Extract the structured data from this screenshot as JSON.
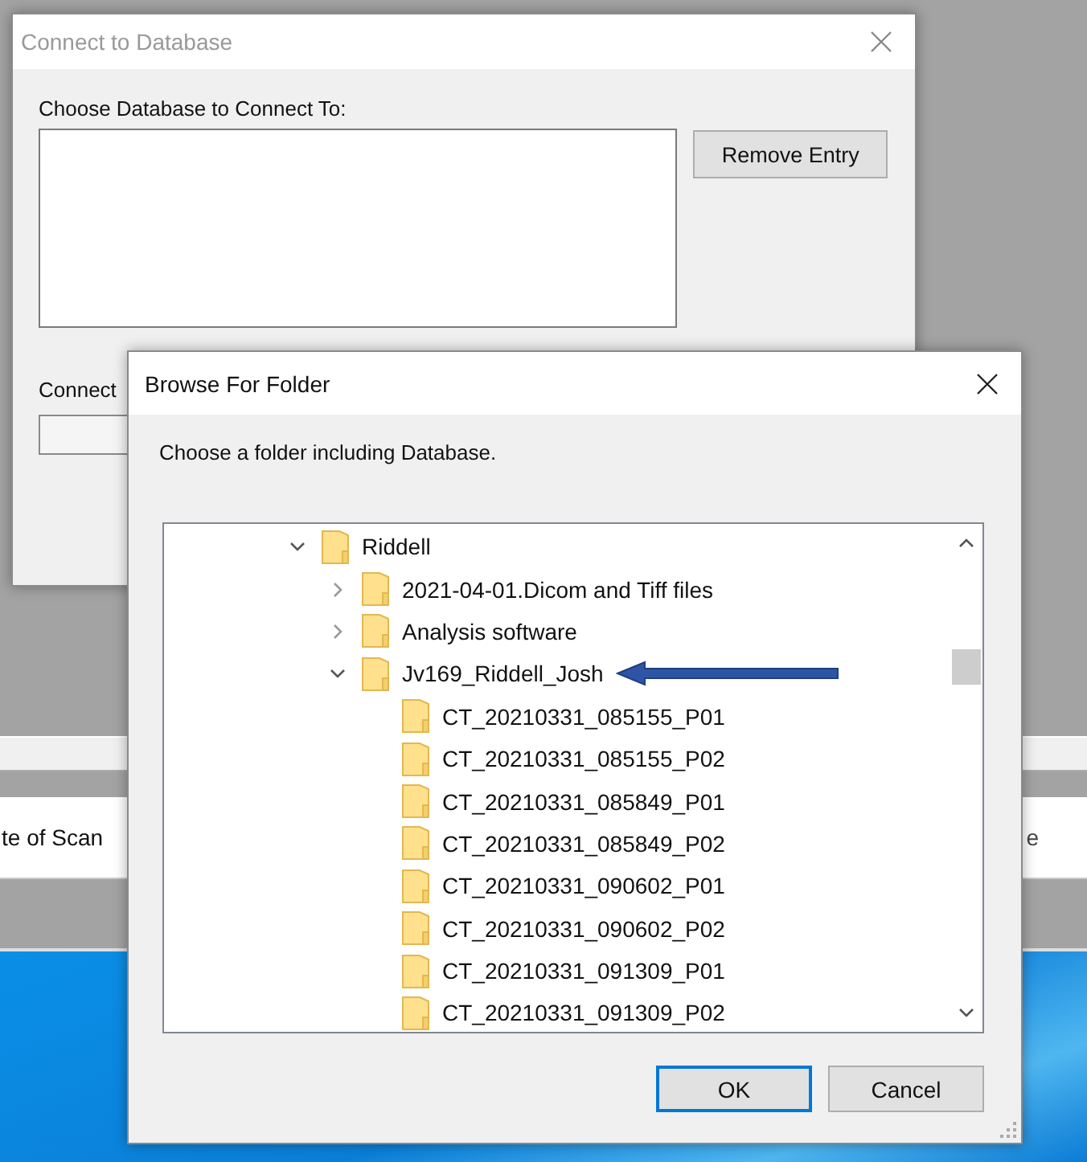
{
  "background_app": {
    "column_1": "te of Scan",
    "column_2": "e"
  },
  "connect_dialog": {
    "title": "Connect to Database",
    "active": false,
    "list_label": "Choose Database to Connect To:",
    "remove_button": "Remove Entry",
    "connect_label": "Connect"
  },
  "browse_dialog": {
    "title": "Browse For Folder",
    "active": true,
    "instruction": "Choose a folder including Database.",
    "tree": [
      {
        "label": "Riddell",
        "expanded": true,
        "arrow": false,
        "children": [
          {
            "label": "2021-04-01.Dicom and Tiff files",
            "expanded": false,
            "arrow": false
          },
          {
            "label": "Analysis software",
            "expanded": false,
            "arrow": false
          },
          {
            "label": "Jv169_Riddell_Josh",
            "expanded": true,
            "arrow": true,
            "children": [
              {
                "label": "CT_20210331_085155_P01",
                "arrow": false
              },
              {
                "label": "CT_20210331_085155_P02",
                "arrow": false
              },
              {
                "label": "CT_20210331_085849_P01",
                "arrow": false
              },
              {
                "label": "CT_20210331_085849_P02",
                "arrow": false
              },
              {
                "label": "CT_20210331_090602_P01",
                "arrow": false
              },
              {
                "label": "CT_20210331_090602_P02",
                "arrow": false
              },
              {
                "label": "CT_20210331_091309_P01",
                "arrow": false
              },
              {
                "label": "CT_20210331_091309_P02",
                "arrow": false
              }
            ]
          }
        ]
      }
    ],
    "buttons": [
      {
        "label": "OK",
        "default": true
      },
      {
        "label": "Cancel",
        "default": false
      }
    ]
  }
}
